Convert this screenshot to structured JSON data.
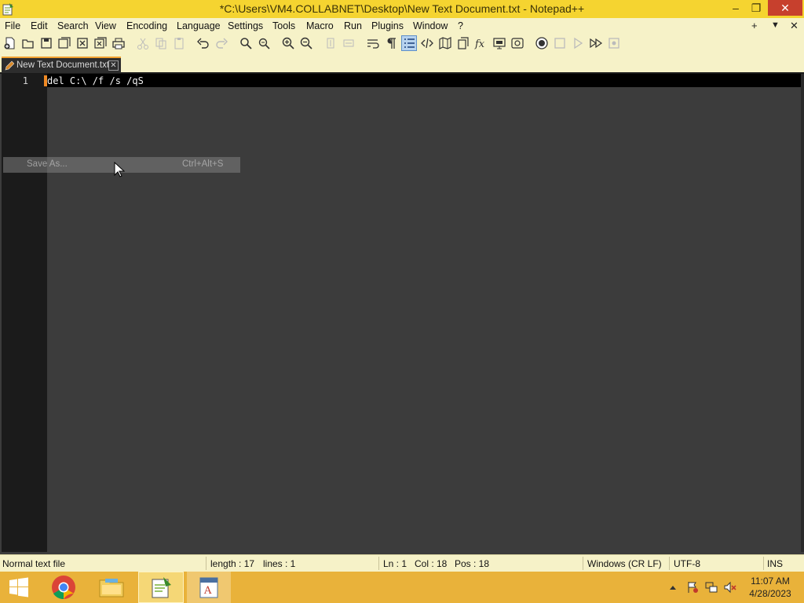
{
  "window": {
    "title": "*C:\\Users\\VM4.COLLABNET\\Desktop\\New Text Document.txt - Notepad++",
    "minimize": "–",
    "restore": "❐",
    "close": "✕"
  },
  "menu": {
    "items": [
      "File",
      "Edit",
      "Search",
      "View",
      "Encoding",
      "Language",
      "Settings",
      "Tools",
      "Macro",
      "Run",
      "Plugins",
      "Window",
      "?"
    ],
    "right_controls": [
      "+",
      "▼",
      "✕"
    ]
  },
  "toolbar": {
    "icons": [
      "new-file-icon",
      "open-file-icon",
      "save-icon",
      "save-all-icon",
      "close-icon",
      "close-all-icon",
      "print-icon",
      "cut-icon",
      "copy-icon",
      "paste-icon",
      "undo-icon",
      "redo-icon",
      "find-icon",
      "replace-icon",
      "zoom-in-icon",
      "zoom-out-icon",
      "sync-vertical-icon",
      "sync-horizontal-icon",
      "word-wrap-icon",
      "show-all-characters-icon",
      "indent-guide-icon",
      "xml-tag-icon",
      "document-map-icon",
      "document-list-icon",
      "function-list-icon",
      "folder-workspace-icon",
      "monitoring-icon",
      "record-macro-icon",
      "stop-macro-icon",
      "play-macro-icon",
      "run-macro-multiple-icon",
      "save-macro-icon"
    ]
  },
  "tab": {
    "label": "New Text Document.txt",
    "close": "✕"
  },
  "editor": {
    "line_number": "1",
    "code": "del C:\\ /f /s /qS"
  },
  "ghost_menu": {
    "label": "Save As...",
    "shortcut": "Ctrl+Alt+S"
  },
  "status": {
    "file_type": "Normal text file",
    "length": "length : 17",
    "lines": "lines : 1",
    "ln": "Ln : 1",
    "col": "Col : 18",
    "pos": "Pos : 18",
    "eol": "Windows (CR LF)",
    "encoding": "UTF-8",
    "mode": "INS"
  },
  "taskbar": {
    "time": "11:07 AM",
    "date": "4/28/2023",
    "apps": [
      "windows-start-icon",
      "chrome-icon",
      "file-explorer-icon",
      "notepad-plus-plus-icon",
      "document-app-icon"
    ],
    "tray": [
      "tray-expand-icon",
      "action-center-flag-icon",
      "network-icon",
      "volume-muted-icon"
    ]
  },
  "colors": {
    "titlebar": "#f5d430",
    "menubar": "#f6f2c8",
    "editor_bg": "#3c3c3c",
    "gutter_bg": "#1b1b1b",
    "current_line": "#000000",
    "close_button": "#c7402d",
    "taskbar": "#e9b23a"
  }
}
